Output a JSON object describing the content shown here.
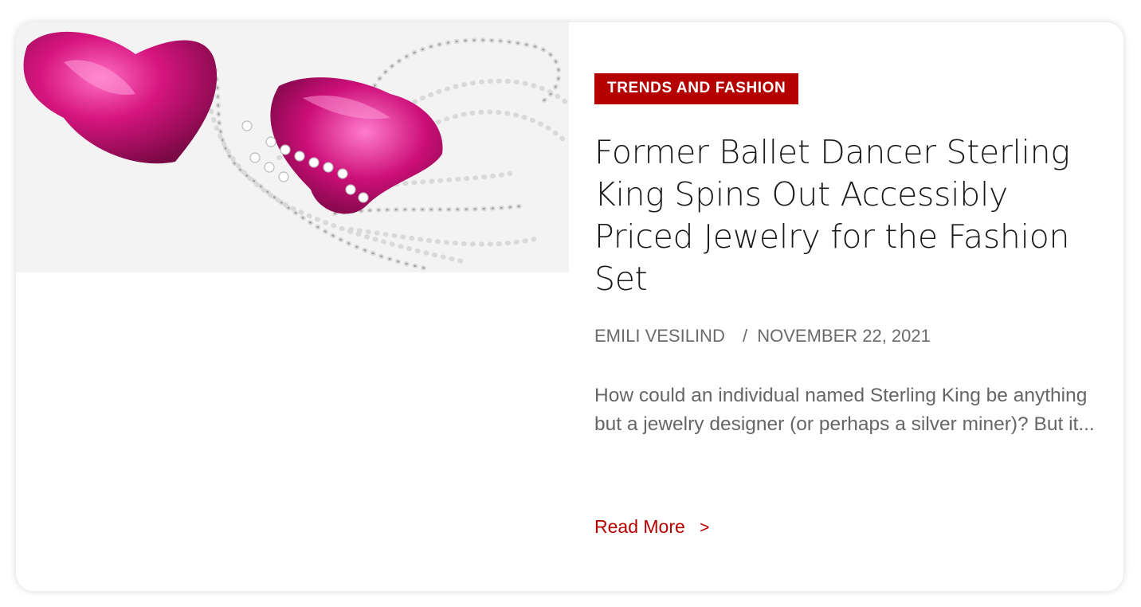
{
  "colors": {
    "accent": "#b50000",
    "badge_background": "#b50000",
    "badge_text": "#ffffff",
    "title_text": "#1a1a1a",
    "meta_text": "#6b6b6b",
    "excerpt_text": "#666666"
  },
  "article": {
    "image": {
      "icon": "jewelry-earrings-photo"
    },
    "category": "TRENDS AND FASHION",
    "title": "Former Ballet Dancer Sterling King Spins Out Accessibly Priced Jewelry for the Fashion Set",
    "author": "EMILI VESILIND",
    "date_separator": "/",
    "date": "NOVEMBER 22, 2021",
    "excerpt": "How could an individual named Sterling King be anything but a jewelry designer (or perhaps a silver miner)? But it...",
    "read_more_label": "Read More",
    "read_more_icon": ">"
  }
}
